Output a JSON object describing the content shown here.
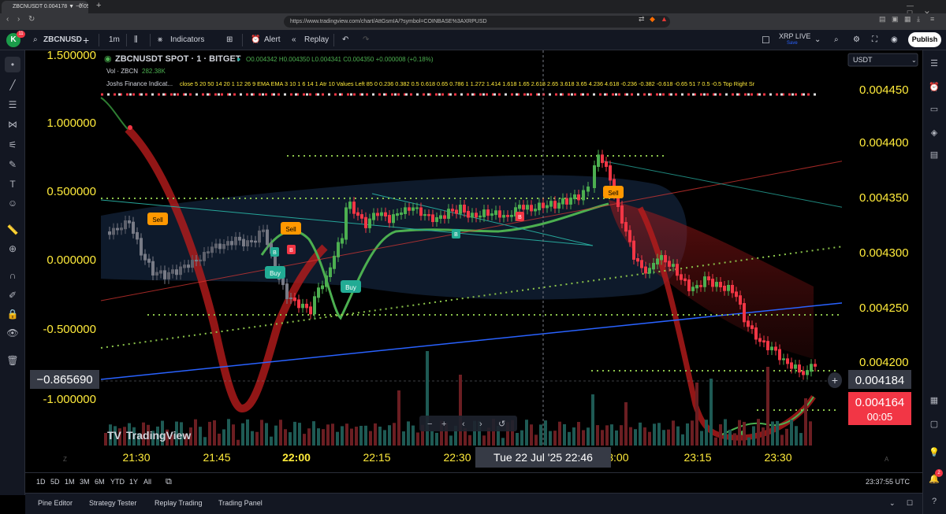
{
  "browser": {
    "tab_title": "ZBCNUSDT 0.004178 ▼ −0.05% ...",
    "tab_close": "✕",
    "new_tab": "+",
    "url": "https://www.tradingview.com/chart/AttGsmIA/?symbol=COINBASE%3AXRPUSD",
    "nav_back": "‹",
    "nav_forward": "›",
    "nav_reload": "↻"
  },
  "toolbar": {
    "avatar_letter": "K",
    "avatar_badge": "11",
    "symbol": "ZBCNUSD",
    "add_symbol": "+",
    "interval": "1m",
    "indicators_label": "Indicators",
    "alert_label": "Alert",
    "replay_label": "Replay",
    "layout_name": "XRP LIVE",
    "layout_status": "Save",
    "publish_label": "Publish"
  },
  "legend": {
    "title": "ZBCNUSDT SPOT · 1 · BITGET",
    "ohlc": "O0.004342 H0.004350 L0.004341 C0.004350 +0.000008 (+0.18%)",
    "vol_label": "Vol · ZBCN",
    "vol_value": "282.38K",
    "indicator_name": "Joshs Finance Indicat...",
    "indicator_params": "close 5 20 50 14 20 1 12 26 9 EMA EMA 3 10 1 6 14 1 Atr 10 Values Left 85 0 0.236 0.382 0.5 0.618 0.65 0.786 1 1.272 1.414 1.618 1.65 2.618 2.65 3.618 3.65 4.236 4.618 -0.236 -0.382 -0.618 -0.65 51 7 0.5 -0.5 Top Right Sr"
  },
  "currency_selector": "USDT",
  "left_scale": {
    "ticks": [
      "1.500000",
      "1.000000",
      "0.500000",
      "0.000000",
      "-0.500000",
      "-1.000000"
    ],
    "current_value": "−0.865690"
  },
  "right_scale": {
    "ticks": [
      "0.004450",
      "0.004400",
      "0.004350",
      "0.004300",
      "0.004250",
      "0.004200"
    ],
    "crosshair_price": "0.004184",
    "last_price": "0.004164",
    "countdown": "00:05"
  },
  "time_axis": {
    "ticks": [
      "21:30",
      "21:45",
      "22:00",
      "22:15",
      "22:30",
      "23:00",
      "23:15",
      "23:30"
    ],
    "crosshair_label": "Tue 22 Jul '25   22:46"
  },
  "signals": {
    "sell": "Sell",
    "buy": "Buy",
    "b": "B"
  },
  "watermark": "TradingView",
  "range_buttons": [
    "1D",
    "5D",
    "1M",
    "3M",
    "6M",
    "YTD",
    "1Y",
    "All"
  ],
  "clock": "23:37:55 UTC",
  "bottom_tabs": [
    "Pine Editor",
    "Strategy Tester",
    "Replay Trading",
    "Trading Panel"
  ],
  "right_badge": "2",
  "colors": {
    "up": "#4caf50",
    "down": "#f23645",
    "sell_tag": "#ff9800",
    "buy_tag": "#22ab94",
    "accent_yellow": "#ffeb3b",
    "trend_blue": "#2962ff"
  }
}
